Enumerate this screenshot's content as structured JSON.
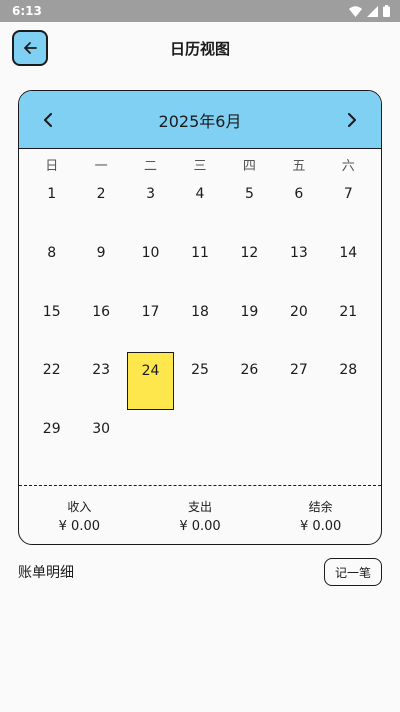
{
  "status_bar": {
    "time": "6:13"
  },
  "header": {
    "title": "日历视图"
  },
  "calendar": {
    "month_label": "2025年6月",
    "weekdays": [
      "日",
      "一",
      "二",
      "三",
      "四",
      "五",
      "六"
    ],
    "selected_day": 24,
    "days": [
      "1",
      "2",
      "3",
      "4",
      "5",
      "6",
      "7",
      "8",
      "9",
      "10",
      "11",
      "12",
      "13",
      "14",
      "15",
      "16",
      "17",
      "18",
      "19",
      "20",
      "21",
      "22",
      "23",
      "24",
      "25",
      "26",
      "27",
      "28",
      "29",
      "30"
    ]
  },
  "summary": {
    "income_label": "收入",
    "income_value": "¥ 0.00",
    "expense_label": "支出",
    "expense_value": "¥ 0.00",
    "balance_label": "结余",
    "balance_value": "¥ 0.00"
  },
  "details": {
    "title": "账单明细",
    "add_label": "记一笔"
  },
  "colors": {
    "accent": "#7fd0f3",
    "selected": "#fde74c",
    "status_bar": "#9e9e9e"
  }
}
